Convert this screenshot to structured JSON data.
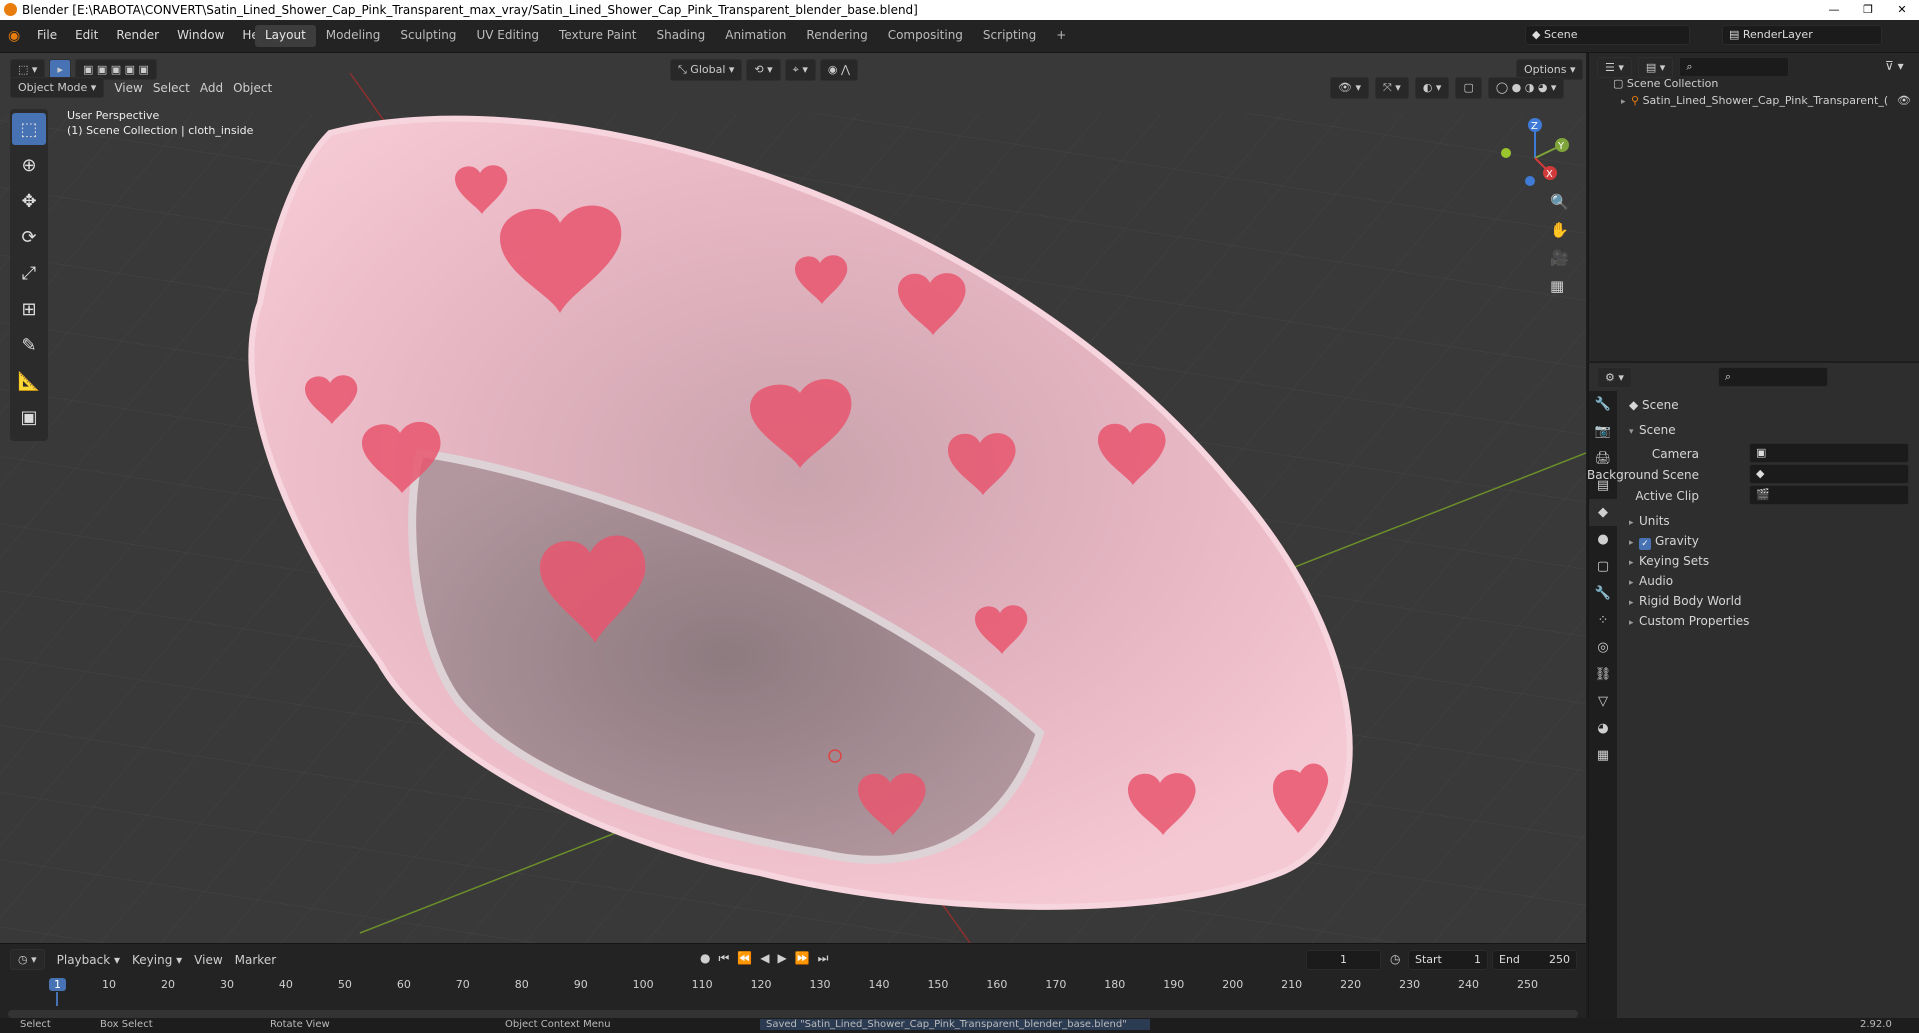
{
  "window": {
    "title": "Blender [E:\\RABOTA\\CONVERT\\Satin_Lined_Shower_Cap_Pink_Transparent_max_vray/Satin_Lined_Shower_Cap_Pink_Transparent_blender_base.blend]"
  },
  "menu": [
    "File",
    "Edit",
    "Render",
    "Window",
    "Help"
  ],
  "workspaces": [
    "Layout",
    "Modeling",
    "Sculpting",
    "UV Editing",
    "Texture Paint",
    "Shading",
    "Animation",
    "Rendering",
    "Compositing",
    "Scripting"
  ],
  "active_workspace": "Layout",
  "scene_field": "Scene",
  "render_layer": "RenderLayer",
  "viewport": {
    "mode": "Object Mode",
    "menus": [
      "View",
      "Select",
      "Add",
      "Object"
    ],
    "transform_orientation": "Global",
    "options_label": "Options",
    "perspective": "User Perspective",
    "collection_info": "(1) Scene Collection | cloth_inside",
    "axes": {
      "x": "X",
      "y": "Y",
      "z": "Z"
    }
  },
  "outliner": {
    "root": "Scene Collection",
    "items": [
      "Satin_Lined_Shower_Cap_Pink_Transparent_("
    ]
  },
  "properties": {
    "header": "Scene",
    "panel": "Scene",
    "fields": [
      {
        "label": "Camera",
        "value": ""
      },
      {
        "label": "Background Scene",
        "value": ""
      },
      {
        "label": "Active Clip",
        "value": ""
      }
    ],
    "sections": [
      "Units",
      "Gravity",
      "Keying Sets",
      "Audio",
      "Rigid Body World",
      "Custom Properties"
    ]
  },
  "timeline": {
    "menus": [
      "Playback",
      "Keying",
      "View",
      "Marker"
    ],
    "current_frame": "1",
    "start_label": "Start",
    "start": "1",
    "end_label": "End",
    "end": "250",
    "ticks": [
      "1",
      "10",
      "20",
      "30",
      "40",
      "50",
      "60",
      "70",
      "80",
      "90",
      "100",
      "110",
      "120",
      "130",
      "140",
      "150",
      "160",
      "170",
      "180",
      "190",
      "200",
      "210",
      "220",
      "230",
      "240",
      "250"
    ]
  },
  "status": {
    "select": "Select",
    "box_select": "Box Select",
    "rotate": "Rotate View",
    "context_menu": "Object Context Menu",
    "message": "Saved \"Satin_Lined_Shower_Cap_Pink_Transparent_blender_base.blend\"",
    "version": "2.92.0"
  },
  "colors": {
    "accent": "#4772b3",
    "cap": "#f2b9c8",
    "heart": "#e8566f",
    "viewport_bg": "#393939"
  }
}
